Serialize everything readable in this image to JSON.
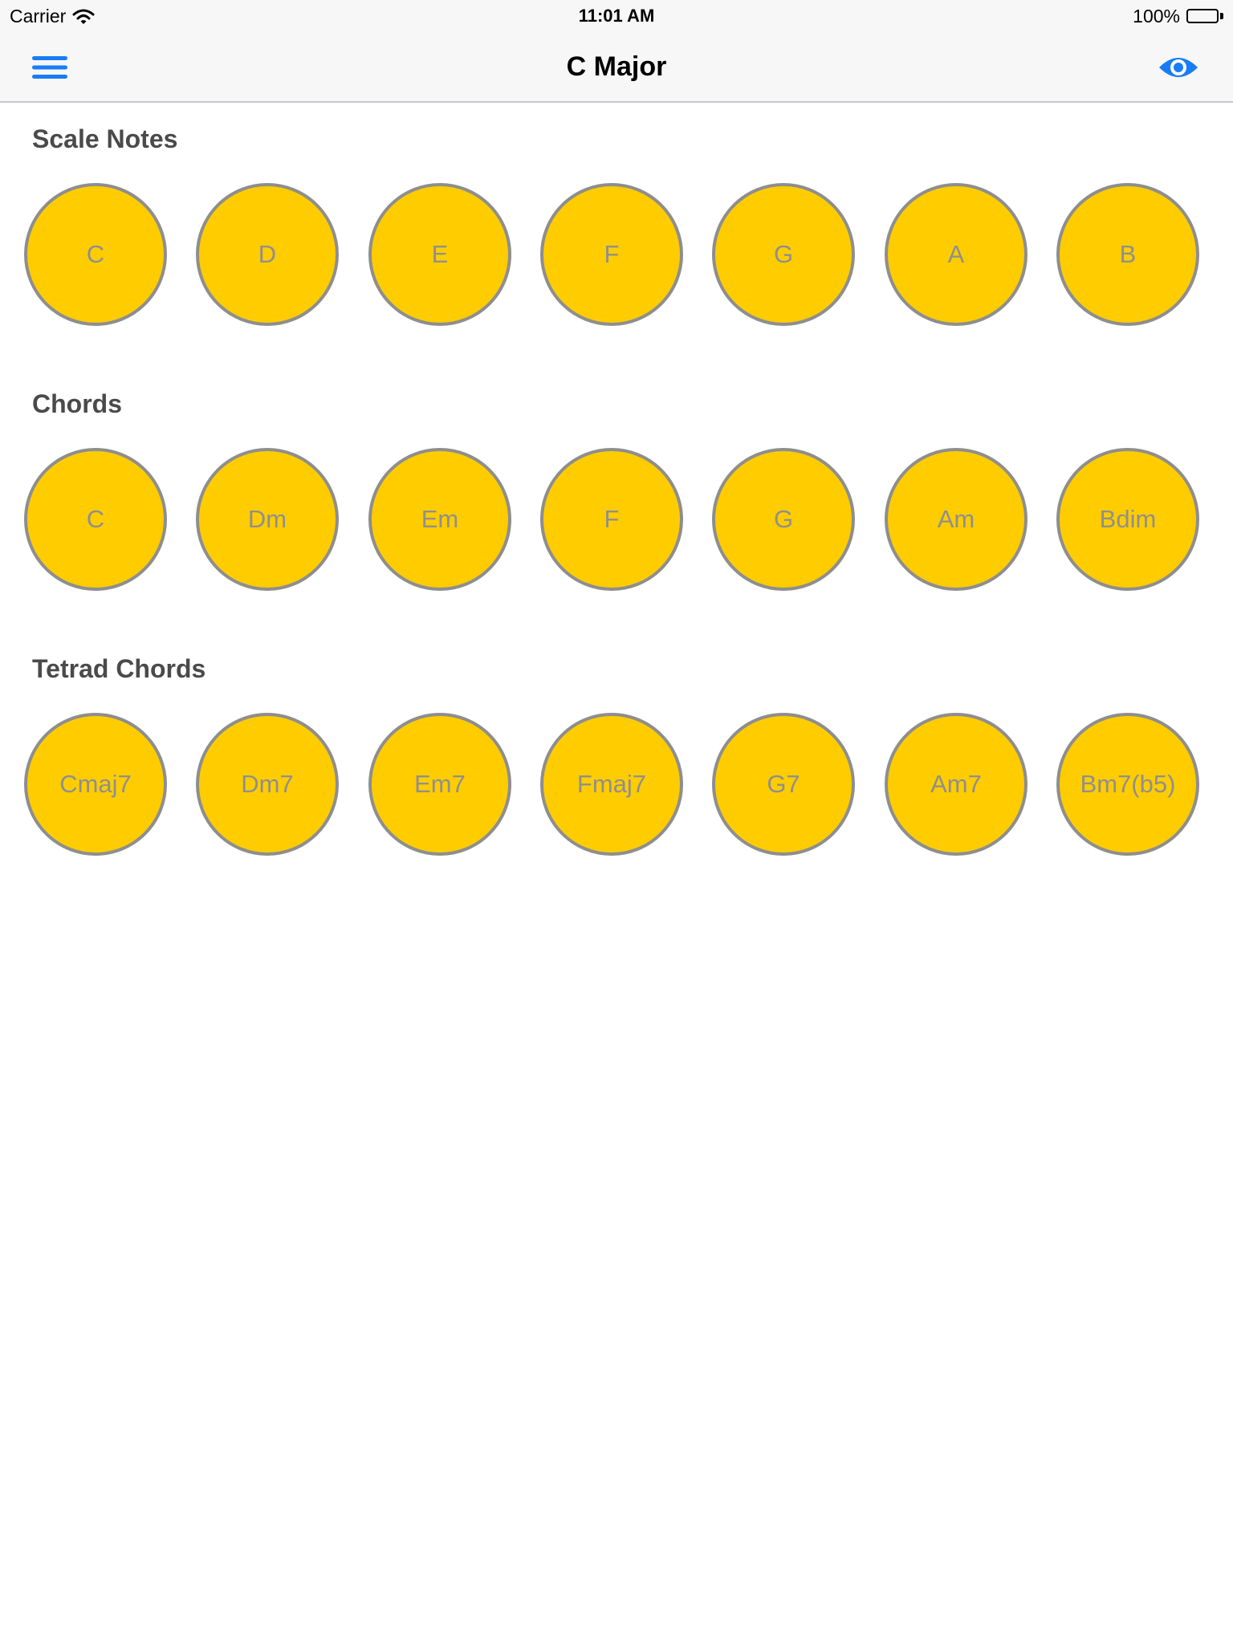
{
  "status_bar": {
    "carrier": "Carrier",
    "time": "11:01 AM",
    "battery": "100%"
  },
  "nav_bar": {
    "title": "C Major",
    "left_icon": "menu-icon",
    "right_icon": "eye-icon",
    "accent_color": "#1a7cf5"
  },
  "sections": [
    {
      "title": "Scale Notes",
      "items": [
        "C",
        "D",
        "E",
        "F",
        "G",
        "A",
        "B"
      ]
    },
    {
      "title": "Chords",
      "items": [
        "C",
        "Dm",
        "Em",
        "F",
        "G",
        "Am",
        "Bdim"
      ]
    },
    {
      "title": "Tetrad Chords",
      "items": [
        "Cmaj7",
        "Dm7",
        "Em7",
        "Fmaj7",
        "G7",
        "Am7",
        "Bm7(b5)"
      ]
    }
  ],
  "colors": {
    "circle_fill": "#ffcc00",
    "circle_border": "#8e8e8e",
    "circle_text": "#8f8f8f",
    "section_title": "#4a4a4a"
  }
}
